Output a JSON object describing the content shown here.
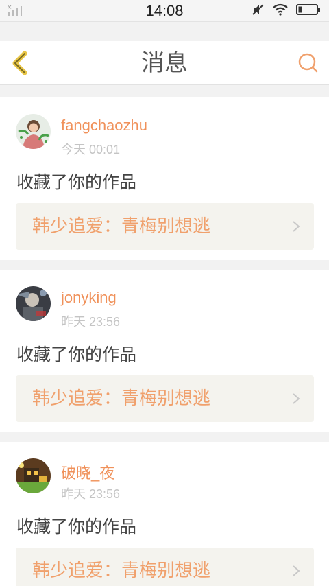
{
  "status_bar": {
    "time": "14:08",
    "icons": [
      "signal-icon",
      "mute-icon",
      "wifi-icon",
      "battery-icon"
    ]
  },
  "header": {
    "title": "消息",
    "back_icon": "chevron-left-icon",
    "search_icon": "search-icon"
  },
  "colors": {
    "accent": "#f0915a",
    "back_arrow": "#e8c547",
    "work_bg": "#f4f3ee"
  },
  "messages": [
    {
      "username": "fangchaozhu",
      "time": "今天 00:01",
      "action": "收藏了你的作品",
      "work_title": "韩少追爱：青梅别想逃"
    },
    {
      "username": "jonyking",
      "time": "昨天 23:56",
      "action": "收藏了你的作品",
      "work_title": "韩少追爱：青梅别想逃"
    },
    {
      "username": "破晓_夜",
      "time": "昨天 23:56",
      "action": "收藏了你的作品",
      "work_title": "韩少追爱：青梅别想逃"
    }
  ]
}
